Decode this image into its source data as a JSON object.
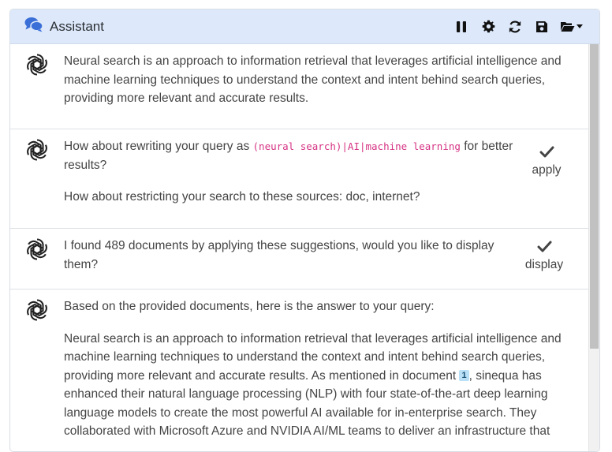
{
  "header": {
    "title": "Assistant",
    "icons": [
      "chat-icon",
      "pause-icon",
      "gear-icon",
      "refresh-icon",
      "save-icon",
      "folder-open-icon",
      "caret-down-icon"
    ]
  },
  "messages": [
    {
      "paragraphs": [
        "Neural search is an approach to information retrieval that leverages artificial intelligence and machine learning techniques to understand the context and intent behind search queries, providing more relevant and accurate results."
      ]
    },
    {
      "rewrite_prefix": "How about rewriting your query as ",
      "rewrite_query": "(neural search)|AI|machine learning",
      "rewrite_suffix": " for better results?",
      "sources_text": "How about restricting your search to these sources: doc, internet?",
      "action_label": "apply"
    },
    {
      "text": "I found 489 documents by applying these suggestions, would you like to display them?",
      "action_label": "display"
    },
    {
      "intro": "Based on the provided documents, here is the answer to your query:",
      "answer_before_ref": "Neural search is an approach to information retrieval that leverages artificial intelligence and machine learning techniques to understand the context and intent behind search queries, providing more relevant and accurate results. As mentioned in document ",
      "ref_number": "1",
      "answer_after_ref": ", sinequa has enhanced their natural language processing (NLP) with four state-of-the-art deep learning language models to create the most powerful AI available for in-enterprise search. They collaborated with Microsoft Azure and NVIDIA AI/ML teams to deliver an infrastructure that"
    }
  ]
}
